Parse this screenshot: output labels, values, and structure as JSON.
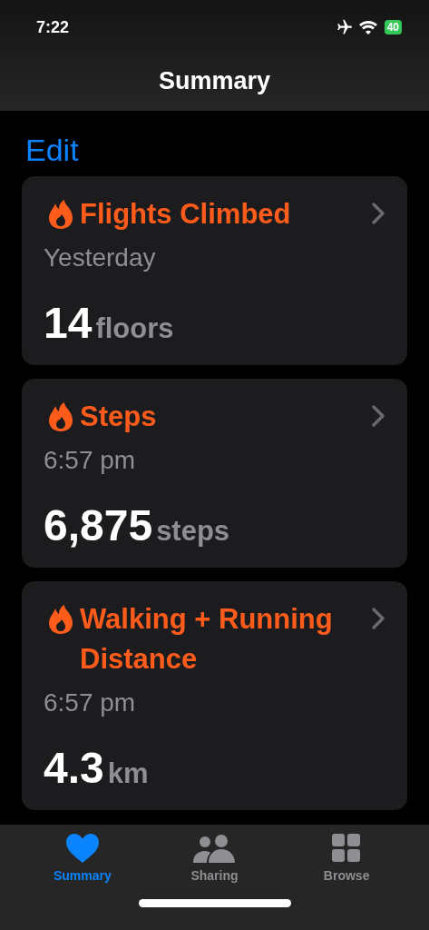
{
  "status_bar": {
    "time": "7:22",
    "battery": "40"
  },
  "nav": {
    "title": "Summary"
  },
  "edit": "Edit",
  "cards": [
    {
      "title": "Flights Climbed",
      "subtitle": "Yesterday",
      "value": "14",
      "unit": "floors"
    },
    {
      "title": "Steps",
      "subtitle": "6:57 pm",
      "value": "6,875",
      "unit": "steps"
    },
    {
      "title": "Walking + Running Distance",
      "subtitle": "6:57 pm",
      "value": "4.3",
      "unit": "km"
    }
  ],
  "tabs": [
    {
      "label": "Summary",
      "kind": "heart",
      "selected": true
    },
    {
      "label": "Sharing",
      "kind": "people",
      "selected": false
    },
    {
      "label": "Browse",
      "kind": "grid",
      "selected": false
    }
  ]
}
